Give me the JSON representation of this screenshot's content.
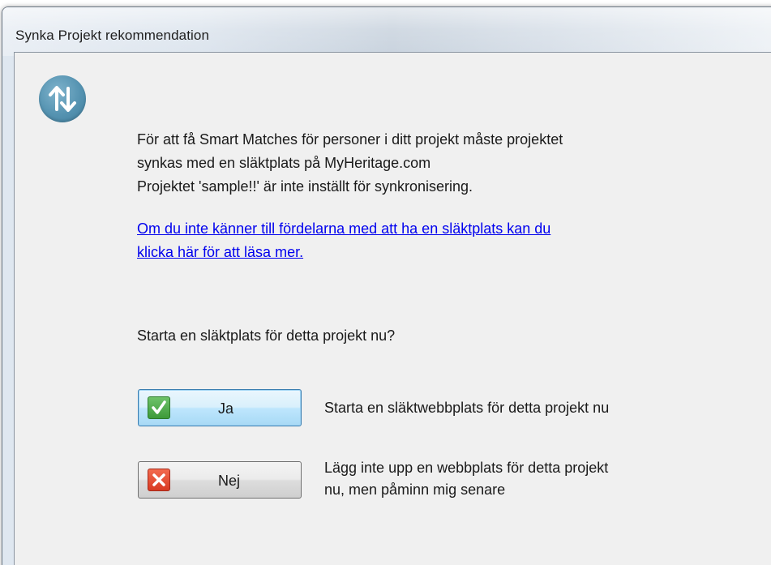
{
  "window": {
    "title": "Synka Projekt rekommendation"
  },
  "icons": {
    "header": "sync-arrows-icon",
    "yes": "checkmark-icon",
    "no": "cross-icon"
  },
  "colors": {
    "link": "#0000ee",
    "icon_blue": "#5593b1",
    "check_green": "#3d9a3a",
    "cross_red": "#d83a22"
  },
  "message": {
    "lines": [
      "För att få Smart Matches för personer i ditt projekt måste projektet",
      "synkas med en släktplats på MyHeritage.com",
      "Projektet 'sample!!' är inte inställt för synkronisering."
    ],
    "link_lines": [
      "Om du inte känner till fördelarna med att ha en släktplats kan du",
      "klicka här för att läsa mer."
    ],
    "question": "Starta en släktplats för detta projekt nu?"
  },
  "buttons": {
    "yes": {
      "label": "Ja",
      "description": "Starta en släktwebbplats för detta projekt nu"
    },
    "no": {
      "label": "Nej",
      "description_lines": [
        "Lägg inte upp en webbplats för detta projekt",
        "nu, men påminn mig senare"
      ]
    }
  }
}
